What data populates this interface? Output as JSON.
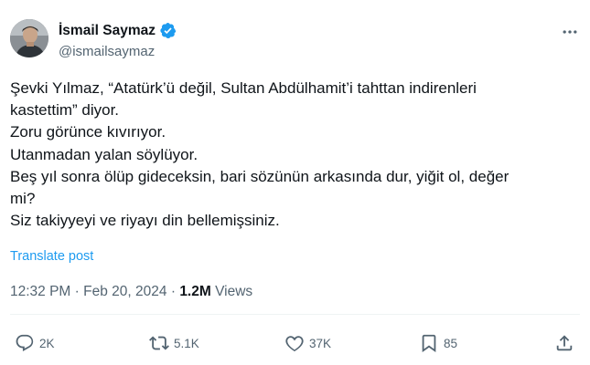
{
  "author": {
    "display_name": "İsmail Saymaz",
    "handle": "@ismailsaymaz",
    "verified": true,
    "avatar_icon": "profile-photo"
  },
  "tweet": {
    "lines": [
      "Şevki Yılmaz, “Atatürk’ü değil, Sultan Abdülhamit’i tahttan indirenleri",
      "kastettim” diyor.",
      "Zoru görünce kıvırıyor.",
      "Utanmadan yalan söylüyor.",
      "Beş yıl sonra ölüp gideceksin, bari sözünün arkasında dur, yiğit ol, değer",
      "mi?",
      "Siz takiyyeyi ve riyayı din bellemişsiniz."
    ],
    "translate_label": "Translate post",
    "time": "12:32 PM",
    "separator": "·",
    "date": "Feb 20, 2024",
    "views_count": "1.2M",
    "views_label": "Views"
  },
  "actions": {
    "reply_count": "2K",
    "repost_count": "5.1K",
    "like_count": "37K",
    "bookmark_count": "85"
  },
  "icons": {
    "more": "more-horizontal-icon",
    "reply": "reply-icon",
    "repost": "repost-icon",
    "like": "heart-icon",
    "bookmark": "bookmark-icon",
    "share": "share-icon",
    "verified": "verified-badge-icon"
  },
  "colors": {
    "text": "#0f1419",
    "secondary": "#536471",
    "accent": "#1d9bf0",
    "divider": "#eff3f4"
  }
}
